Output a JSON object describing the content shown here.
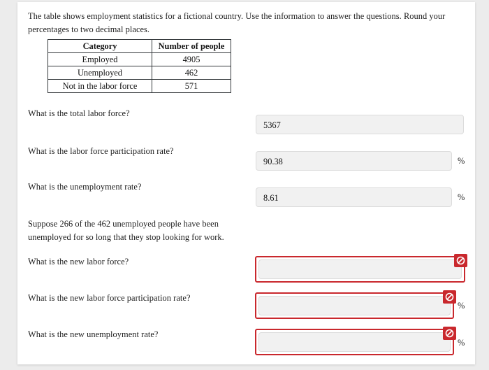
{
  "intro": {
    "text": "The table shows employment statistics for a fictional country. Use the information to answer the questions. Round your percentages to two decimal places."
  },
  "table": {
    "headers": [
      "Category",
      "Number of people"
    ],
    "rows": [
      {
        "category": "Employed",
        "count": "4905"
      },
      {
        "category": "Unemployed",
        "count": "462"
      },
      {
        "category": "Not in the labor force",
        "count": "571"
      }
    ]
  },
  "questions": [
    {
      "label": "What is the total labor force?",
      "value": "5367",
      "suffix": "",
      "state": "filled"
    },
    {
      "label": "What is the labor force participation rate?",
      "value": "90.38",
      "suffix": "%",
      "state": "filled"
    },
    {
      "label": "What is the unemployment rate?",
      "value": "8.61",
      "suffix": "%",
      "state": "filled"
    }
  ],
  "scenario": {
    "text": "Suppose 266 of the 462 unemployed people have been unemployed for so long that they stop looking for work."
  },
  "questions2": [
    {
      "label": "What is the new labor force?",
      "value": "",
      "suffix": "",
      "state": "error",
      "icon": "prohibition-icon"
    },
    {
      "label": "What is the new labor force participation rate?",
      "value": "",
      "suffix": "%",
      "state": "error",
      "icon": "prohibition-icon"
    },
    {
      "label": "What is the new unemployment rate?",
      "value": "",
      "suffix": "%",
      "state": "error",
      "icon": "prohibition-icon"
    }
  ],
  "colors": {
    "error": "#c9282d",
    "field_bg": "#f1f1f1",
    "field_border": "#dcdcdc",
    "page_bg": "#ececec",
    "card_bg": "#ffffff"
  }
}
